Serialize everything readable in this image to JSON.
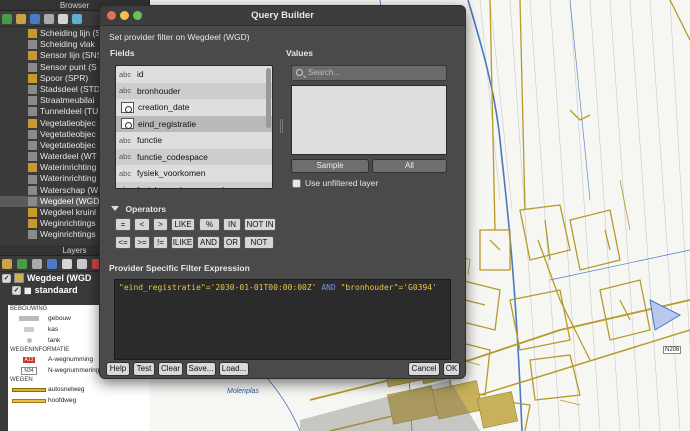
{
  "browser": {
    "title": "Browser",
    "items": [
      {
        "label": "Scheiding lijn (S",
        "icon_color": "#c79a2e"
      },
      {
        "label": "Scheiding vlak",
        "icon_color": "#8a8a8a"
      },
      {
        "label": "Sensor lijn (SNS",
        "icon_color": "#c79a2e"
      },
      {
        "label": "Sensor punt (S",
        "icon_color": "#8a8a8a"
      },
      {
        "label": "Spoor (SPR)",
        "icon_color": "#c79a2e"
      },
      {
        "label": "Stadsdeel (STD",
        "icon_color": "#8a8a8a"
      },
      {
        "label": "Straatmeubilai",
        "icon_color": "#8a8a8a"
      },
      {
        "label": "Tunneldeel (TU",
        "icon_color": "#8a8a8a"
      },
      {
        "label": "Vegetatieobjec",
        "icon_color": "#c79a2e"
      },
      {
        "label": "Vegetatieobjec",
        "icon_color": "#8a8a8a"
      },
      {
        "label": "Vegetatieobjec",
        "icon_color": "#8a8a8a"
      },
      {
        "label": "Waterdeel (WT",
        "icon_color": "#8a8a8a"
      },
      {
        "label": "Waterinrichting",
        "icon_color": "#c79a2e"
      },
      {
        "label": "Waterinrichting",
        "icon_color": "#8a8a8a"
      },
      {
        "label": "Waterschap (W",
        "icon_color": "#8a8a8a"
      },
      {
        "label": "Wegdeel (WGD",
        "icon_color": "#8a8a8a",
        "selected": true
      },
      {
        "label": "Wegdeel kruinl",
        "icon_color": "#c79a2e"
      },
      {
        "label": "Weginrichtings",
        "icon_color": "#c79a2e"
      },
      {
        "label": "Weginrichtings",
        "icon_color": "#8a8a8a"
      }
    ]
  },
  "layers": {
    "title": "Layers",
    "layer1": "Wegdeel (WGD",
    "layer2": "standaard",
    "legend": {
      "bebouwing": "BEBOUWING",
      "gebouw": "gebouw",
      "kas": "kas",
      "tank": "tank",
      "wegeninfo": "WEGENINFORMATIE",
      "a_wegnr": "A-wegnumming",
      "a_badge": "A13",
      "n_wegnr": "N-wegnummering",
      "n_badge": "N34",
      "wegen": "WEGEN",
      "autosnelweg": "autosnelweg",
      "hoofdweg": "hoofdweg"
    }
  },
  "dialog": {
    "title": "Query Builder",
    "subtitle": "Set provider filter on Wegdeel (WGD)",
    "fields_label": "Fields",
    "values_label": "Values",
    "fields": [
      {
        "type": "abc",
        "name": "id"
      },
      {
        "type": "abc",
        "name": "bronhouder"
      },
      {
        "type": "date",
        "name": "creation_date"
      },
      {
        "type": "date",
        "name": "eind_registratie"
      },
      {
        "type": "abc",
        "name": "functie"
      },
      {
        "type": "abc",
        "name": "functie_codespace"
      },
      {
        "type": "abc",
        "name": "fysiek_voorkomen"
      },
      {
        "type": "abc",
        "name": "fysiek_voorkomen_codespace"
      }
    ],
    "search_placeholder": "Search...",
    "sample_label": "Sample",
    "all_label": "All",
    "unfiltered_label": "Use unfiltered layer",
    "operators_label": "Operators",
    "operators_row1": [
      "=",
      "<",
      ">",
      "LIKE",
      "%",
      "IN",
      "NOT IN"
    ],
    "operators_row2": [
      "<=",
      ">=",
      "!=",
      "ILIKE",
      "AND",
      "OR",
      "NOT"
    ],
    "expression_label": "Provider Specific Filter Expression",
    "expression": {
      "part1": "\"eind_registratie\"='2030-01-01T00:00:00Z'",
      "keyword": "AND",
      "part2": "\"bronhouder\"='G0394'"
    },
    "buttons": {
      "help": "Help",
      "test": "Test",
      "clear": "Clear",
      "save": "Save...",
      "load": "Load...",
      "cancel": "Cancel",
      "ok": "OK"
    }
  },
  "map": {
    "label_water": "Molenplas",
    "road_badge": "N206"
  }
}
